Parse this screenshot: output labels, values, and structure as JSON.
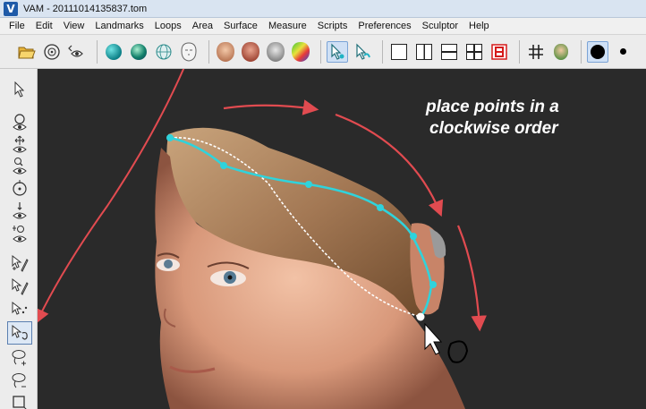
{
  "window": {
    "title": "VAM - 20111014135837.tom",
    "app_icon": "V"
  },
  "menu": [
    "File",
    "Edit",
    "View",
    "Landmarks",
    "Loops",
    "Area",
    "Surface",
    "Measure",
    "Scripts",
    "Preferences",
    "Sculptor",
    "Help"
  ],
  "toolbar": {
    "buttons": [
      "open-folder-icon",
      "head-view-icon",
      "eye-rotate-icon",
      "sphere-teal-icon",
      "sphere-green-icon",
      "sphere-wire-icon",
      "face-outline-icon",
      "face-skin-icon",
      "face-red-icon",
      "face-gray-icon",
      "face-heatmap-icon",
      "select-arrow-icon",
      "select-loop-icon",
      "single-view-icon",
      "two-vertical-view-icon",
      "two-horizontal-view-icon",
      "four-view-icon",
      "view-red-icon",
      "grid-icon",
      "face-small-icon",
      "point-size-large-icon",
      "point-size-medium-icon",
      "point-size-small-icon"
    ],
    "selected": "select-arrow-icon"
  },
  "left_toolbar": {
    "tools": [
      "select-arrow-tool",
      "rotate-eye-tool",
      "pan-eye-tool",
      "zoom-eye-tool",
      "spin-tool",
      "move-down-eye-tool",
      "zoom-plus-eye-tool",
      "add-landmark-tool",
      "edit-landmark-tool",
      "delete-landmark-tool",
      "loop-place-tool",
      "lasso-plus-tool",
      "lasso-minus-tool",
      "rectangle-select-tool"
    ],
    "selected": "loop-place-tool"
  },
  "annotation": {
    "line1": "place points in a",
    "line2": "clockwise order"
  },
  "colors": {
    "curve": "#2fd3dc",
    "arrow": "#e14b50",
    "background": "#2a2a2a"
  }
}
